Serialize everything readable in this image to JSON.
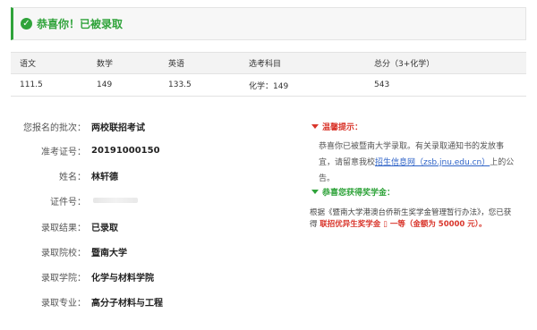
{
  "banner": {
    "title": "恭喜你！已被录取",
    "icon": "check-circle-icon",
    "accent": "#2fa33a"
  },
  "scores": {
    "headers": [
      "语文",
      "数学",
      "英语",
      "选考科目",
      "总分（3+化学）"
    ],
    "values": [
      "111.5",
      "149",
      "133.5",
      "化学：149",
      "543"
    ]
  },
  "info": [
    {
      "label": "您报名的批次：",
      "value": "两校联招考试"
    },
    {
      "label": "准考证号：",
      "value": "20191000150"
    },
    {
      "label": "姓名：",
      "value": "林轩德"
    },
    {
      "label": "证件号：",
      "value": ""
    },
    {
      "label": "录取结果：",
      "value": "已录取"
    },
    {
      "label": "录取院校：",
      "value": "暨南大学"
    },
    {
      "label": "录取学院：",
      "value": "化学与材料学院"
    },
    {
      "label": "录取专业：",
      "value": "高分子材料与工程"
    }
  ],
  "notice": {
    "title": "温馨提示：",
    "text_before": "恭喜你已被暨南大学录取。有关录取通知书的发放事宜，请留意我校",
    "link_text": "招生信息网（zsb.jnu.edu.cn）",
    "text_after": "上的公告。"
  },
  "award": {
    "title": "恭喜您获得奖学金：",
    "line1": "根据《暨南大学港澳台侨新生奖学金管理暂行办法》，您已获",
    "line2_prefix": "得",
    "line2_highlight": "联招优异生奖学金 ▯ 一等（金额为 50000 元）。"
  },
  "colors": {
    "green": "#2fa33a",
    "red": "#d9352b",
    "link": "#2d62c7"
  }
}
